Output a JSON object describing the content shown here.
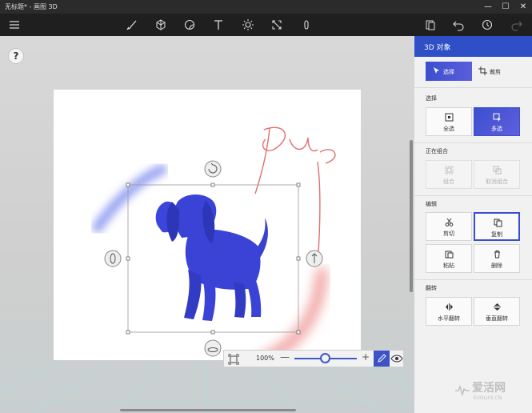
{
  "window": {
    "title": "无标题* - 画图 3D",
    "minimize": "—",
    "maximize": "☐",
    "close": "✕"
  },
  "toolbar": {
    "tools": [
      "menu-icon",
      "brush-icon",
      "cube-icon",
      "sticker-icon",
      "text-icon",
      "effects-icon",
      "canvas-icon",
      "3d-library-icon"
    ],
    "right_tools": [
      "paste-icon",
      "undo-icon",
      "history-icon",
      "redo-icon"
    ]
  },
  "canvas": {
    "help_label": "?",
    "handwriting": "pup"
  },
  "zoom": {
    "value": "100%",
    "minus": "—",
    "plus": "+",
    "level": 0.5
  },
  "panel": {
    "title": "3D 对象",
    "modes": {
      "select": "选择",
      "crop": "裁剪"
    },
    "sections": {
      "select": {
        "label": "选择",
        "items": [
          {
            "label": "全选"
          },
          {
            "label": "多选"
          }
        ]
      },
      "group": {
        "label": "正在组合",
        "items": [
          {
            "label": "组合"
          },
          {
            "label": "取消组合"
          }
        ]
      },
      "edit": {
        "label": "编辑",
        "items": [
          {
            "label": "剪切"
          },
          {
            "label": "复制"
          },
          {
            "label": "粘贴"
          },
          {
            "label": "删除"
          }
        ]
      },
      "flip": {
        "label": "翻转",
        "items": [
          {
            "label": "水平翻转"
          },
          {
            "label": "垂直翻转"
          }
        ]
      }
    }
  },
  "watermark": {
    "brand": "爱活网",
    "site": "EVOLIFE.CN"
  },
  "colors": {
    "accent": "#3b4fce",
    "dog": "#3a43d6",
    "red_stroke": "#e86464",
    "blue_stroke": "#7f8cef"
  }
}
